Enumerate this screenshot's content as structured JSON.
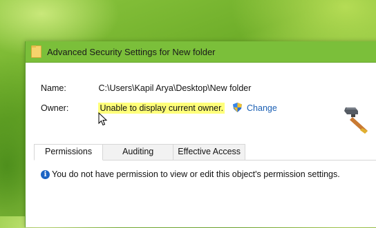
{
  "window": {
    "title": "Advanced Security Settings for New folder"
  },
  "details": {
    "name_label": "Name:",
    "name_value": "C:\\Users\\Kapil Arya\\Desktop\\New folder",
    "owner_label": "Owner:",
    "owner_value": "Unable to display current owner.",
    "change_link": "Change"
  },
  "tabs": [
    {
      "label": "Permissions",
      "active": true
    },
    {
      "label": "Auditing",
      "active": false
    },
    {
      "label": "Effective Access",
      "active": false
    }
  ],
  "message": {
    "icon": "info-icon",
    "text": "You do not have permission to view or edit this object's permission settings."
  },
  "colors": {
    "titlebar": "#7bbf3a",
    "highlight": "#ffff7a",
    "link": "#1a5fb4",
    "info": "#1c64c4"
  }
}
